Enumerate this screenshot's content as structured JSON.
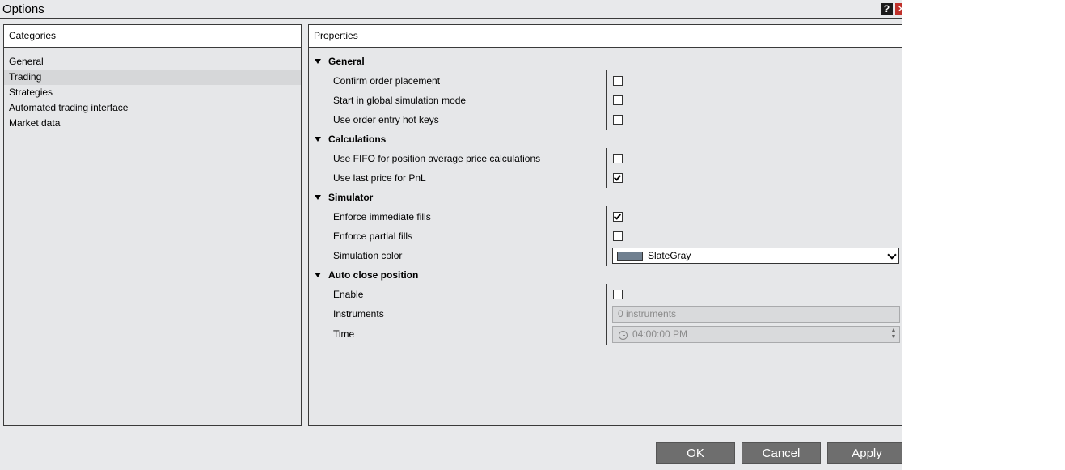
{
  "window": {
    "title": "Options",
    "help_label": "?",
    "close_label": "✕"
  },
  "categories": {
    "header": "Categories",
    "items": [
      "General",
      "Trading",
      "Strategies",
      "Automated trading interface",
      "Market data"
    ],
    "selected": "Trading"
  },
  "properties": {
    "header": "Properties",
    "general": {
      "title": "General",
      "confirm_order_placement": {
        "label": "Confirm order placement",
        "checked": false
      },
      "start_global_sim": {
        "label": "Start in global simulation mode",
        "checked": false
      },
      "order_entry_hot_keys": {
        "label": "Use order entry hot keys",
        "checked": false
      }
    },
    "calculations": {
      "title": "Calculations",
      "fifo": {
        "label": "Use FIFO for position average price calculations",
        "checked": false
      },
      "last_price_pnl": {
        "label": "Use last price for PnL",
        "checked": true
      }
    },
    "simulator": {
      "title": "Simulator",
      "immediate_fills": {
        "label": "Enforce immediate fills",
        "checked": true
      },
      "partial_fills": {
        "label": "Enforce partial fills",
        "checked": false
      },
      "sim_color": {
        "label": "Simulation color",
        "value": "SlateGray",
        "swatch": "#708090"
      }
    },
    "auto_close": {
      "title": "Auto close position",
      "enable": {
        "label": "Enable",
        "checked": false
      },
      "instruments": {
        "label": "Instruments",
        "value": "0 instruments"
      },
      "time": {
        "label": "Time",
        "value": "04:00:00 PM"
      }
    }
  },
  "buttons": {
    "ok": "OK",
    "cancel": "Cancel",
    "apply": "Apply"
  }
}
